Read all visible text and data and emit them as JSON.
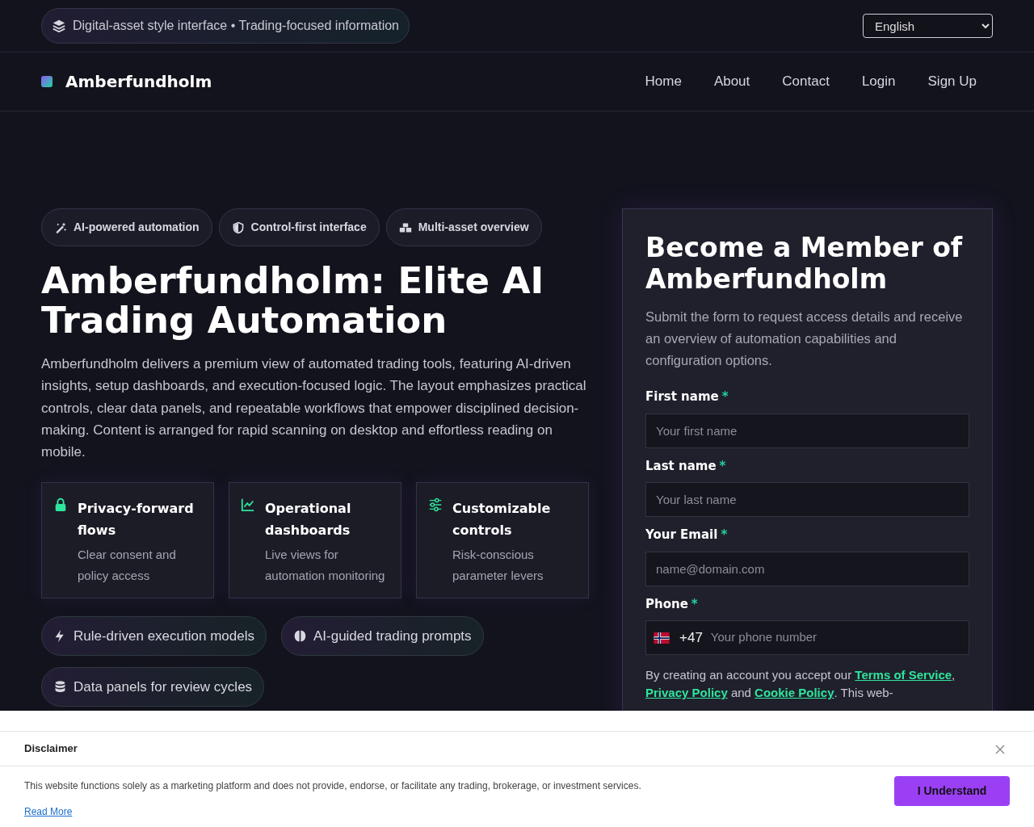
{
  "topbar": {
    "notice": "Digital-asset style interface • Trading-focused information",
    "language": "English"
  },
  "navbar": {
    "brand": "Amberfundholm",
    "links": [
      {
        "label": "Home"
      },
      {
        "label": "About"
      },
      {
        "label": "Contact"
      },
      {
        "label": "Login"
      },
      {
        "label": "Sign Up"
      }
    ]
  },
  "hero": {
    "chips": [
      {
        "label": "AI-powered automation"
      },
      {
        "label": "Control-first interface"
      },
      {
        "label": "Multi-asset overview"
      }
    ],
    "title": "Amberfundholm: Elite AI Trading Automation",
    "description": "Amberfundholm delivers a premium view of automated trading tools, featuring AI-driven insights, setup dashboards, and execution-focused logic. The layout emphasizes practical controls, clear data panels, and repeatable workflows that empower disciplined decision-making. Content is arranged for rapid scanning on desktop and effortless reading on mobile.",
    "features": [
      {
        "title": "Privacy-forward flows",
        "text": "Clear consent and policy access"
      },
      {
        "title": "Operational dashboards",
        "text": "Live views for automation monitoring"
      },
      {
        "title": "Customizable controls",
        "text": "Risk-conscious parameter levers"
      }
    ],
    "pills": [
      {
        "label": "Rule-driven execution models"
      },
      {
        "label": "AI-guided trading prompts"
      },
      {
        "label": "Data panels for review cycles"
      }
    ]
  },
  "signup": {
    "title": "Become a Member of Amberfundholm",
    "subtitle": "Submit the form to request access details and receive an overview of automation capabilities and configuration options.",
    "fields": [
      {
        "kind": "text",
        "label": "First name",
        "mark": "*",
        "placeholder": "Your first name"
      },
      {
        "kind": "text",
        "label": "Last name",
        "mark": "*",
        "placeholder": "Your last name"
      },
      {
        "kind": "email",
        "label": "Your Email",
        "mark": "*",
        "placeholder": "name@domain.com"
      },
      {
        "kind": "phone",
        "label": "Phone",
        "mark": "*",
        "dial_code": "+47",
        "placeholder": "Your phone number"
      }
    ],
    "consent": [
      {
        "kind": "text",
        "text": "By creating an account you accept our "
      },
      {
        "kind": "link",
        "text": "Terms of Service"
      },
      {
        "kind": "text",
        "text": ", "
      },
      {
        "kind": "link",
        "text": "Privacy Policy"
      },
      {
        "kind": "text",
        "text": " and "
      },
      {
        "kind": "link",
        "text": "Cookie Policy"
      },
      {
        "kind": "text",
        "text": ". This web-"
      }
    ]
  },
  "disclaimer": {
    "title": "Disclaimer",
    "text": "This website functions solely as a marketing platform and does not provide, endorse, or facilitate any trading, brokerage, or investment services.",
    "read_more": "Read More",
    "button": "I Understand"
  }
}
